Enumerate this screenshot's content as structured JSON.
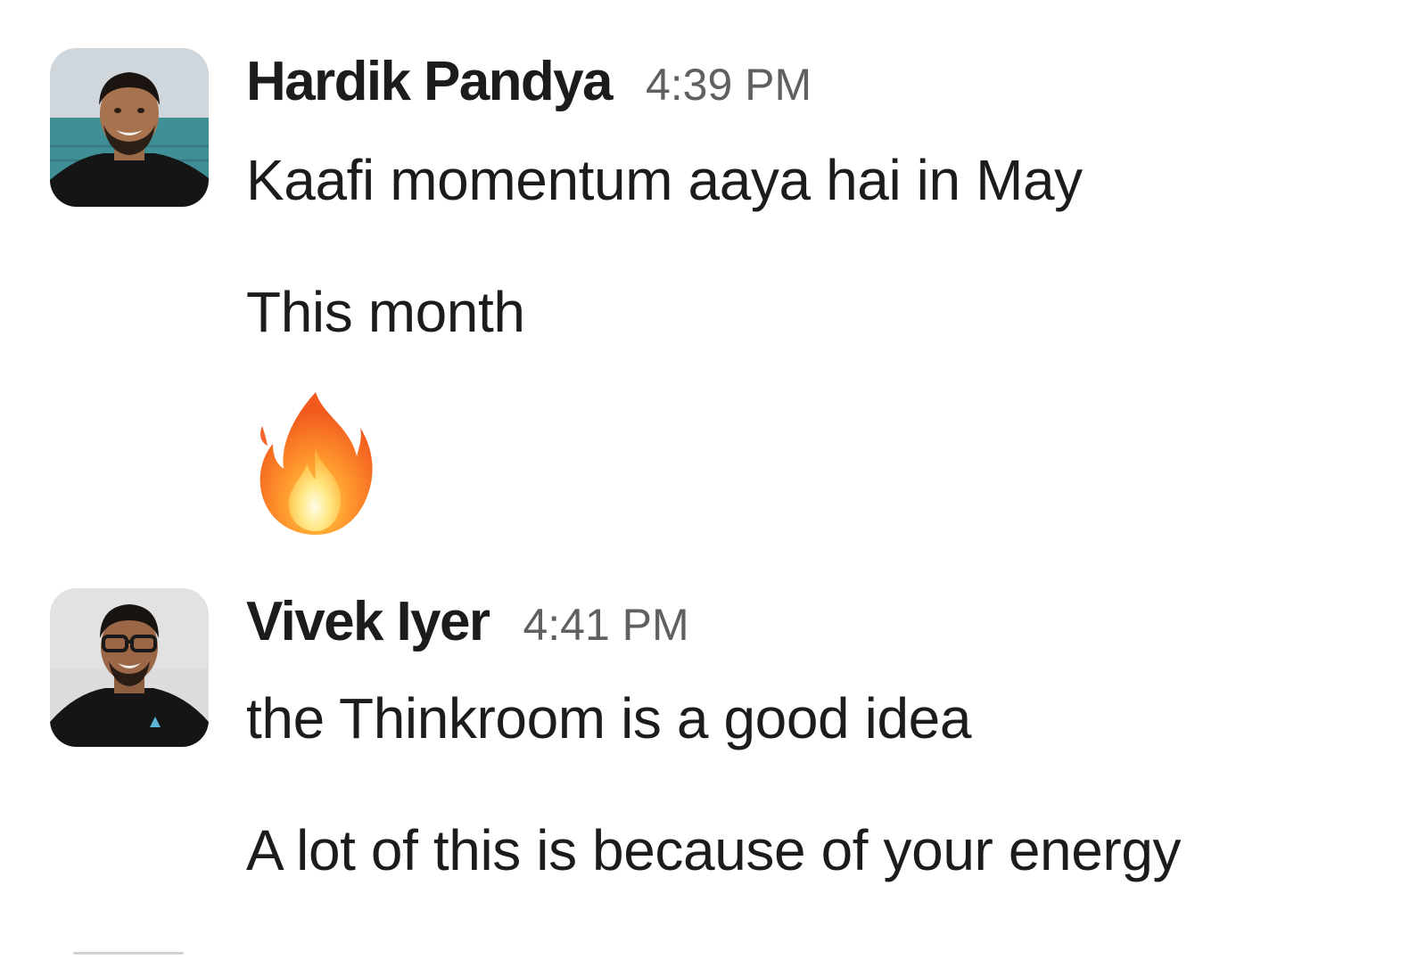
{
  "messages": [
    {
      "sender": "Hardik Pandya",
      "time": "4:39 PM",
      "lines": [
        "Kaafi momentum aaya hai in May",
        "This month"
      ],
      "emoji": "fire-emoji"
    },
    {
      "sender": "Vivek Iyer",
      "time": "4:41 PM",
      "lines": [
        "the Thinkroom is a good idea",
        "A lot of this is because of your energy"
      ]
    }
  ],
  "colors": {
    "text": "#1d1c1d",
    "timestamp": "#616061",
    "background": "#ffffff"
  }
}
